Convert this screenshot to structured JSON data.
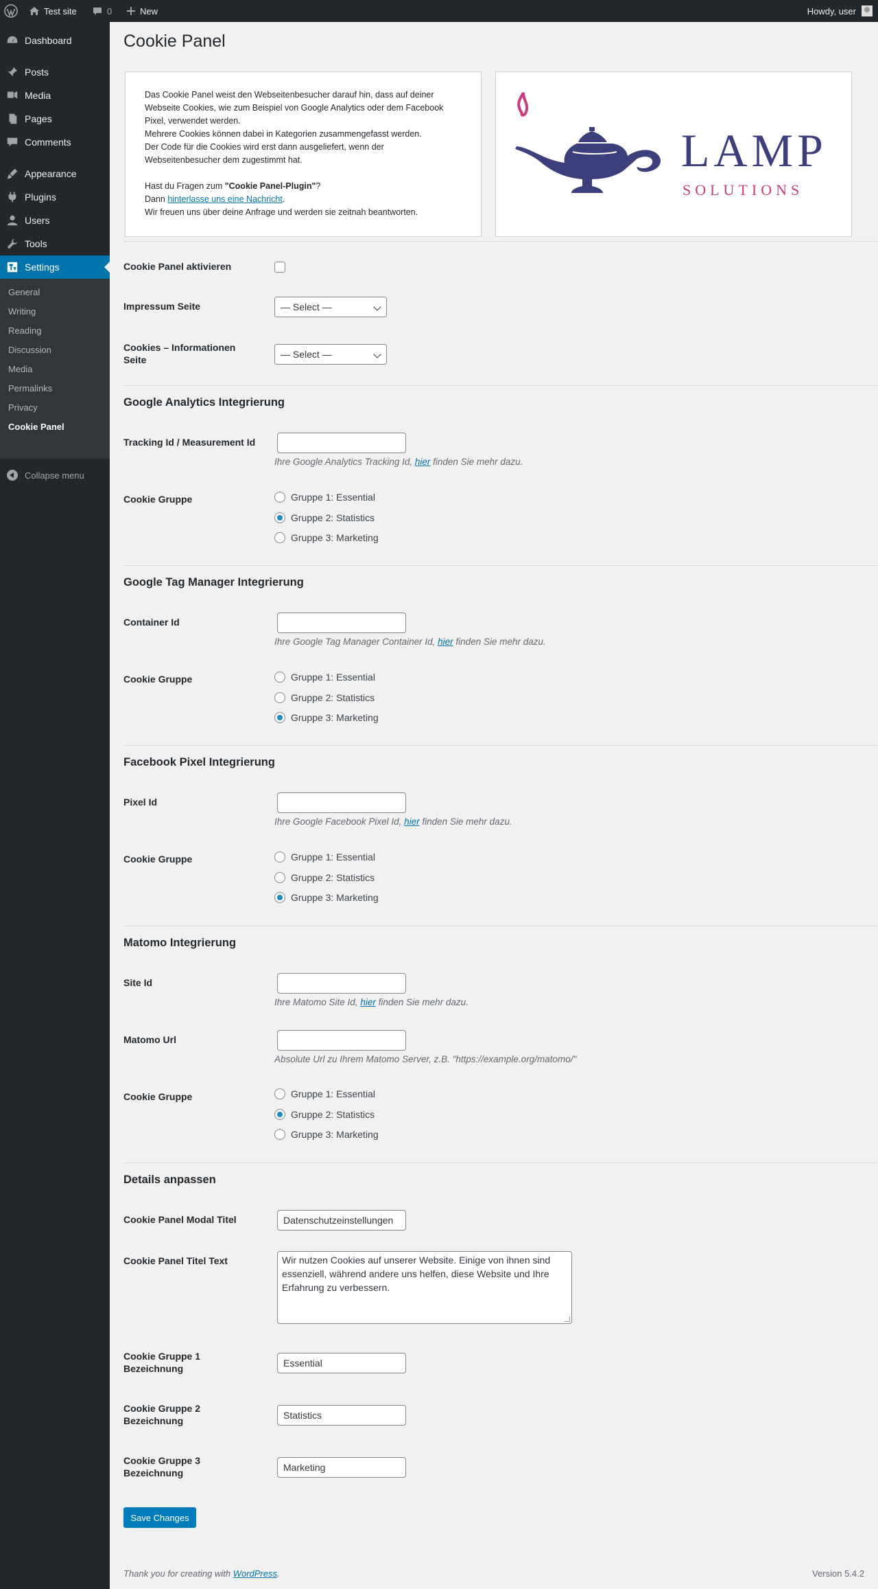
{
  "adminbar": {
    "site_name": "Test site",
    "comments_count": "0",
    "new_label": "New",
    "howdy": "Howdy, user"
  },
  "sidebar": {
    "items": [
      {
        "label": "Dashboard",
        "icon": "dashboard-icon"
      },
      {
        "label": "Posts",
        "icon": "pin-icon"
      },
      {
        "label": "Media",
        "icon": "media-icon"
      },
      {
        "label": "Pages",
        "icon": "pages-icon"
      },
      {
        "label": "Comments",
        "icon": "comment-icon"
      },
      {
        "label": "Appearance",
        "icon": "brush-icon"
      },
      {
        "label": "Plugins",
        "icon": "plug-icon"
      },
      {
        "label": "Users",
        "icon": "user-icon"
      },
      {
        "label": "Tools",
        "icon": "wrench-icon"
      },
      {
        "label": "Settings",
        "icon": "settings-icon"
      }
    ],
    "submenu": [
      "General",
      "Writing",
      "Reading",
      "Discussion",
      "Media",
      "Permalinks",
      "Privacy",
      "Cookie Panel"
    ],
    "collapse_label": "Collapse menu"
  },
  "page": {
    "title": "Cookie Panel",
    "intro": {
      "line1": "Das Cookie Panel weist den Webseitenbesucher darauf hin, dass auf deiner Webseite Cookies, wie zum Beispiel von Google Analytics oder dem Facebook Pixel, verwendet werden.",
      "line2": "Mehrere Cookies können dabei in Kategorien zusammengefasst werden.",
      "line3": "Der Code für die Cookies wird erst dann ausgeliefert, wenn der Webseitenbesucher dem zugestimmt hat.",
      "question_prefix": "Hast du Fragen zum ",
      "question_bold": "\"Cookie Panel-Plugin\"",
      "question_suffix": "?",
      "then_prefix": "Dann ",
      "then_link": "hinterlasse uns eine Nachricht",
      "then_suffix": ".",
      "closing": "Wir freuen uns über deine Anfrage und werden sie zeitnah beantworten."
    },
    "logo": {
      "word1": "LAMP",
      "word2": "SOLUTIONS",
      "primary_color": "#3c3f7b",
      "accent_color": "#c93d7e"
    }
  },
  "general": {
    "activate_label": "Cookie Panel aktivieren",
    "impressum_label": "Impressum Seite",
    "impressum_value": "— Select —",
    "cookies_info_label": "Cookies – Informationen Seite",
    "cookies_info_value": "— Select —"
  },
  "ga": {
    "title": "Google Analytics Integrierung",
    "id_label": "Tracking Id / Measurement Id",
    "id_value": "",
    "desc_prefix": "Ihre Google Analytics Tracking Id, ",
    "desc_link": "hier",
    "desc_suffix": " finden Sie mehr dazu.",
    "group_label": "Cookie Gruppe"
  },
  "gtm": {
    "title": "Google Tag Manager Integrierung",
    "id_label": "Container Id",
    "id_value": "",
    "desc_prefix": "Ihre Google Tag Manager Container Id, ",
    "desc_link": "hier",
    "desc_suffix": " finden Sie mehr dazu.",
    "group_label": "Cookie Gruppe"
  },
  "fb": {
    "title": "Facebook Pixel Integrierung",
    "id_label": "Pixel Id",
    "id_value": "",
    "desc_prefix": "Ihre Google Facebook Pixel Id, ",
    "desc_link": "hier",
    "desc_suffix": " finden Sie mehr dazu.",
    "group_label": "Cookie Gruppe"
  },
  "matomo": {
    "title": "Matomo Integrierung",
    "site_label": "Site Id",
    "site_value": "",
    "site_desc_prefix": "Ihre Matomo Site Id, ",
    "site_desc_link": "hier",
    "site_desc_suffix": " finden Sie mehr dazu.",
    "url_label": "Matomo Url",
    "url_value": "",
    "url_desc": "Absolute Url zu Ihrem Matomo Server, z.B. \"https://example.org/matomo/\"",
    "group_label": "Cookie Gruppe"
  },
  "groups": [
    "Gruppe 1: Essential",
    "Gruppe 2: Statistics",
    "Gruppe 3: Marketing"
  ],
  "details": {
    "title": "Details anpassen",
    "modal_title_label": "Cookie Panel Modal Titel",
    "modal_title_value": "Datenschutzeinstellungen",
    "title_text_label": "Cookie Panel Titel Text",
    "title_text_value": "Wir nutzen Cookies auf unserer Website. Einige von ihnen sind essenziell, während andere uns helfen, diese Website und Ihre Erfahrung zu verbessern.",
    "g1_label": "Cookie Gruppe 1 Bezeichnung",
    "g1_value": "Essential",
    "g2_label": "Cookie Gruppe 2 Bezeichnung",
    "g2_value": "Statistics",
    "g3_label": "Cookie Gruppe 3 Bezeichnung",
    "g3_value": "Marketing"
  },
  "save_label": "Save Changes",
  "footer": {
    "thanks_prefix": "Thank you for creating with ",
    "thanks_link": "WordPress",
    "thanks_suffix": ".",
    "version": "Version 5.4.2"
  }
}
